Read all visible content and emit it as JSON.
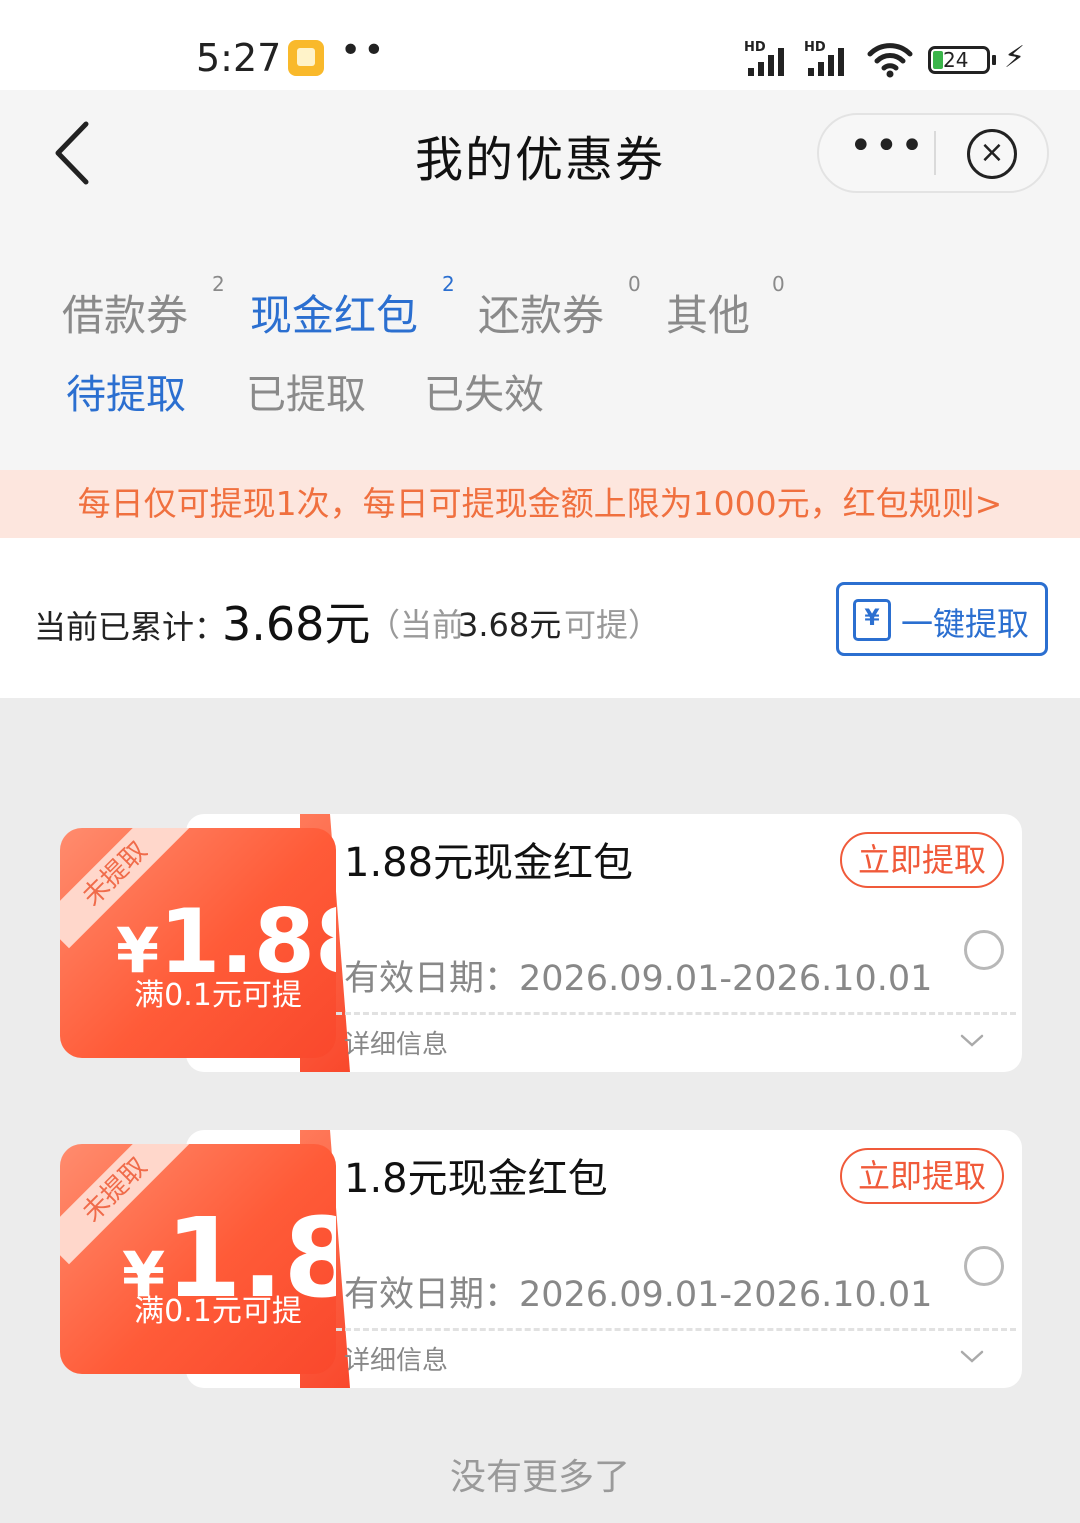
{
  "status_bar": {
    "time": "5:27",
    "dots": "••",
    "battery": "24"
  },
  "header": {
    "title": "我的优惠券",
    "more": "•••",
    "close": "×"
  },
  "tabs": [
    {
      "label": "借款券",
      "count": "2"
    },
    {
      "label": "现金红包",
      "count": "2",
      "active": true
    },
    {
      "label": "还款券",
      "count": "0"
    },
    {
      "label": "其他",
      "count": "0"
    }
  ],
  "subtabs": [
    {
      "label": "待提取",
      "active": true
    },
    {
      "label": "已提取"
    },
    {
      "label": "已失效"
    }
  ],
  "notice": "每日仅可提现1次，每日可提现金额上限为1000元，红包规则>",
  "summary": {
    "label": "当前已累计：",
    "value": "3.68元",
    "note_open": "（当前",
    "note_amount": "3.68元",
    "note_close": "可提）",
    "claim_all": "一键提取",
    "claim_icon": "¥"
  },
  "coupons": [
    {
      "tag": "未提取",
      "yen": "¥",
      "amount": "1.88",
      "condition": "满0.1元可提",
      "title": "1.88元现金红包",
      "claim": "立即提取",
      "date": "有效日期：2026.09.01-2026.10.01",
      "detail": "详细信息"
    },
    {
      "tag": "未提取",
      "yen": "¥",
      "amount": "1.8",
      "condition": "满0.1元可提",
      "title": "1.8元现金红包",
      "claim": "立即提取",
      "date": "有效日期：2026.09.01-2026.10.01",
      "detail": "详细信息"
    }
  ],
  "footer": "没有更多了",
  "colors": {
    "accent": "#2b6fd0",
    "coupon": "#ff5b38",
    "notice_bg": "#fde6de"
  },
  "icons": [
    "back-arrow-icon",
    "more-icon",
    "close-circle-icon",
    "withdraw-icon",
    "chevron-down-icon",
    "wifi-icon",
    "signal-icon",
    "battery-icon",
    "charging-icon"
  ]
}
